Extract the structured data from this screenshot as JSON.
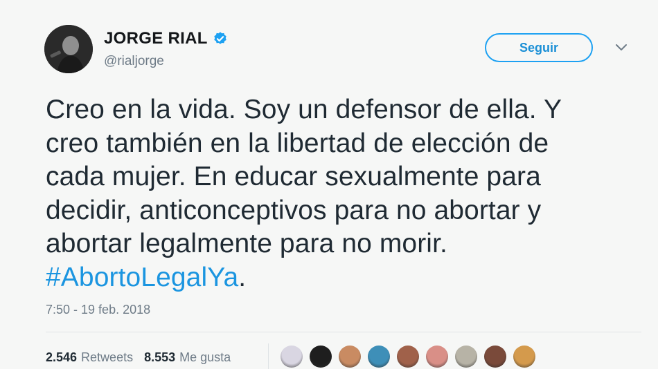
{
  "user": {
    "display_name": "JORGE RIAL",
    "handle": "@rialjorge",
    "verified": true
  },
  "actions": {
    "follow_label": "Seguir"
  },
  "tweet": {
    "lines": [
      "Creo en la vida. Soy un defensor de ella. Y",
      "creo también en la libertad de elección de",
      "cada mujer. En educar sexualmente para",
      "decidir, anticonceptivos para no abortar y",
      "abortar legalmente para no morir."
    ],
    "hashtag": "#AbortoLegalYa",
    "hashtag_suffix": ".",
    "timestamp": "7:50 - 19 feb. 2018"
  },
  "stats": {
    "retweets_count": "2.546",
    "retweets_label": "Retweets",
    "likes_count": "8.553",
    "likes_label": "Me gusta"
  },
  "liker_avatars": [
    {
      "color": "#d9d6e2"
    },
    {
      "color": "#1e1e1e"
    },
    {
      "color": "#c98b62"
    },
    {
      "color": "#3e8fb8"
    },
    {
      "color": "#a0614a"
    },
    {
      "color": "#d98f87"
    },
    {
      "color": "#b7b3a6"
    },
    {
      "color": "#7a4a3a"
    },
    {
      "color": "#d49a4c"
    }
  ],
  "colors": {
    "accent": "#1da1f2",
    "hashtag": "#1b95e0",
    "verified": "#1da1f2"
  }
}
